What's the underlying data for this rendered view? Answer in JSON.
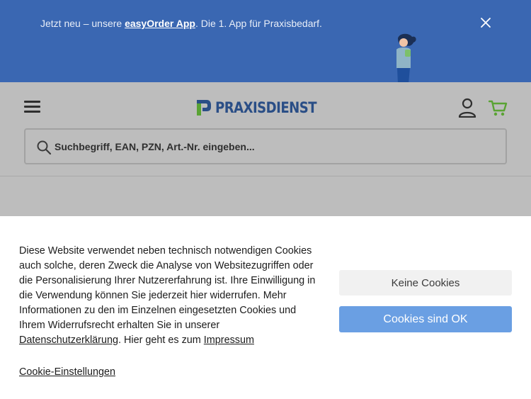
{
  "promo": {
    "text_before": "Jetzt neu – unsere ",
    "app_link": "easyOrder App",
    "text_after": ". Die 1. App für Praxisbedarf.",
    "close_icon": "close-icon",
    "colors": {
      "background": "#3a67b2",
      "text": "#e8eef8"
    }
  },
  "header": {
    "menu_icon": "hamburger-menu-icon",
    "logo_text": "PRAXISDIENST",
    "account_icon": "user-account-icon",
    "cart_icon": "shopping-cart-icon",
    "colors": {
      "logo_blue": "#2a4e86",
      "logo_green": "#5aa334",
      "cart_green": "#5aa334"
    }
  },
  "search": {
    "icon": "search-icon",
    "placeholder": "Suchbegriff, EAN, PZN, Art.-Nr. eingeben..."
  },
  "cookie": {
    "text_1": "Diese Website verwendet neben technisch notwendigen Cookies auch solche, deren Zweck die Analyse von Websitezugriffen oder die Personalisierung Ihrer Nutzererfahrung ist. Ihre Einwilligung in die Verwendung können Sie jederzeit hier widerrufen. Mehr Informationen zu den im Einzelnen eingesetzten Cookies und Ihrem Widerrufsrecht erhalten Sie in unserer ",
    "privacy_link": "Datenschutzerklärung",
    "text_2": ". Hier geht es zum ",
    "imprint_link": "Impressum",
    "settings_link": "Cookie-Einstellungen",
    "no_cookies_label": "Keine Cookies",
    "accept_label": "Cookies sind OK",
    "colors": {
      "accept_button": "#6a9fe3",
      "decline_button": "#f1f1f1"
    }
  }
}
